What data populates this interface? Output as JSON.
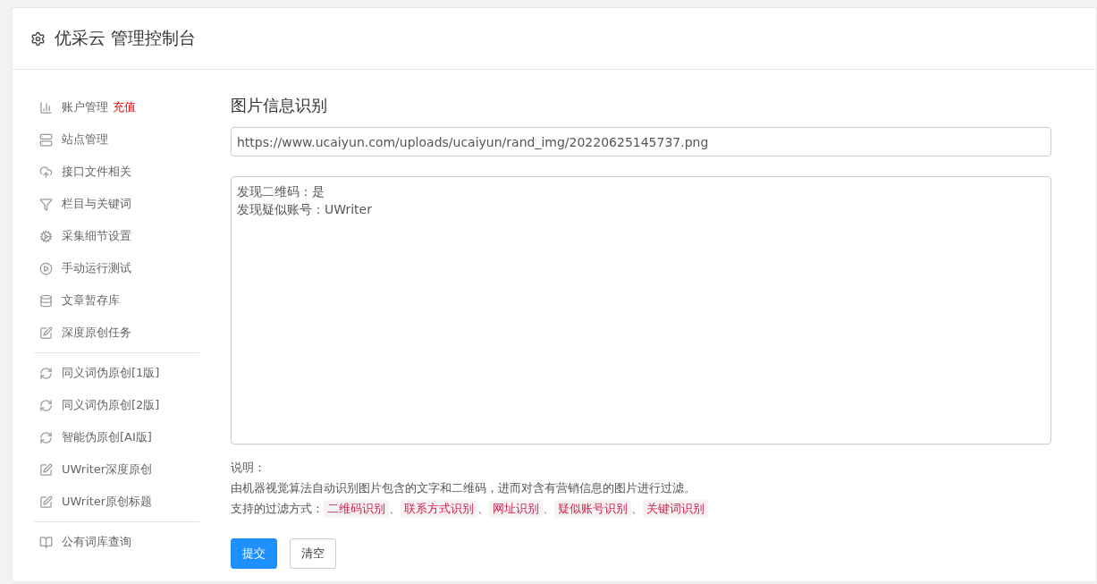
{
  "header": {
    "title": "优采云 管理控制台"
  },
  "sidebar": {
    "groups": [
      {
        "items": [
          {
            "label": "账户管理",
            "badge": "充值"
          },
          {
            "label": "站点管理"
          },
          {
            "label": "接口文件相关"
          },
          {
            "label": "栏目与关键词"
          },
          {
            "label": "采集细节设置"
          },
          {
            "label": "手动运行测试"
          },
          {
            "label": "文章暂存库"
          },
          {
            "label": "深度原创任务"
          }
        ]
      },
      {
        "items": [
          {
            "label": "同义词伪原创[1版]"
          },
          {
            "label": "同义词伪原创[2版]"
          },
          {
            "label": "智能伪原创[AI版]"
          },
          {
            "label": "UWriter深度原创"
          },
          {
            "label": "UWriter原创标题"
          }
        ]
      },
      {
        "items": [
          {
            "label": "公有词库查询"
          }
        ]
      }
    ]
  },
  "main": {
    "title": "图片信息识别",
    "url_field": {
      "value": "https://www.ucaiyun.com/uploads/ucaiyun/rand_img/20220625145737.png"
    },
    "result_lines": [
      "发现二维码：是",
      "发现疑似账号：UWriter"
    ],
    "notes": {
      "heading": "说明：",
      "description": "由机器视觉算法自动识别图片包含的文字和二维码，进而对含有营销信息的图片进行过滤。",
      "methods_label": "支持的过滤方式：",
      "methods": [
        "二维码识别",
        "联系方式识别",
        "网址识别",
        "疑似账号识别",
        "关键词识别"
      ],
      "separator": "、"
    },
    "buttons": [
      {
        "label": "提交",
        "kind": "primary"
      },
      {
        "label": "清空",
        "kind": "default"
      }
    ]
  }
}
